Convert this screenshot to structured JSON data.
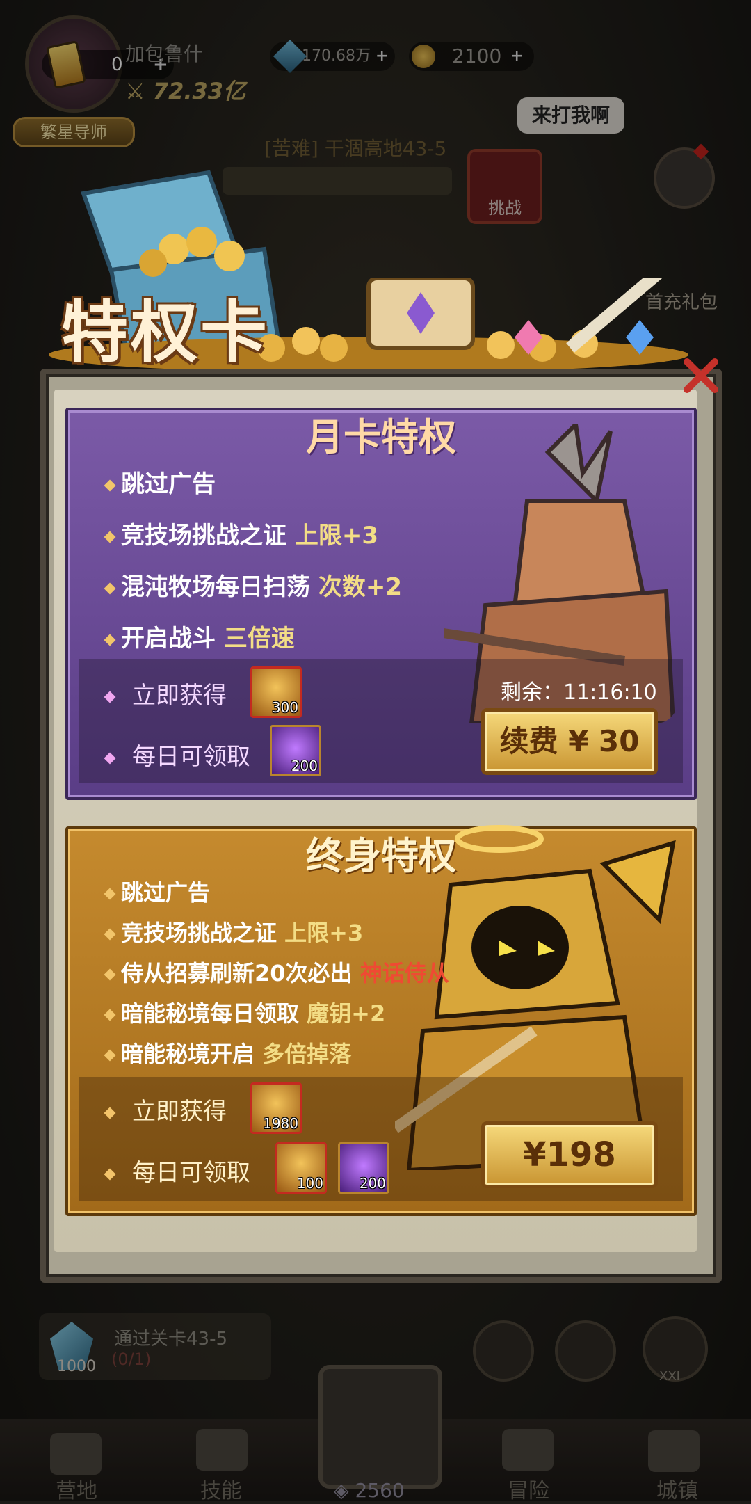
{
  "hud": {
    "card_count": "0",
    "player_name": "加包鲁什",
    "power": "72.33亿",
    "title_badge": "繁星导师",
    "gems": "170.68万",
    "coins": "2100",
    "plus": "+"
  },
  "scene": {
    "speech_bubble": "来打我啊",
    "stage_title": "[苦难] 干涸高地43-5",
    "challenge_label": "挑战",
    "first_pack_label": "首充礼包"
  },
  "modal": {
    "title": "特权卡",
    "monthly": {
      "title": "月卡特权",
      "features": [
        {
          "text": "跳过广告",
          "highlight": ""
        },
        {
          "text": "竞技场挑战之证 ",
          "highlight": "上限+3"
        },
        {
          "text": "混沌牧场每日扫荡 ",
          "highlight": "次数+2"
        },
        {
          "text": "开启战斗 ",
          "highlight": "三倍速"
        }
      ],
      "instant_label": "立即获得",
      "daily_label": "每日可领取",
      "instant_qty": "300",
      "daily_qty": "200",
      "remaining": "剩余：11:16:10",
      "button": "续费 ¥ 30"
    },
    "lifetime": {
      "title": "终身特权",
      "features": [
        {
          "text": "跳过广告",
          "highlight": ""
        },
        {
          "text": "竞技场挑战之证 ",
          "highlight": "上限+3"
        },
        {
          "text": "侍从招募刷新20次必出 ",
          "highlight": "神话侍从"
        },
        {
          "text": "暗能秘境每日领取 ",
          "highlight": "魔钥+2"
        },
        {
          "text": "暗能秘境开启 ",
          "highlight": "多倍掉落"
        }
      ],
      "instant_label": "立即获得",
      "daily_label": "每日可领取",
      "instant_qty": "1980",
      "daily_qty_gold": "100",
      "daily_qty_purple": "200",
      "button": "¥198"
    }
  },
  "quest": {
    "text": "通过关卡43-5",
    "progress": "(0/1)",
    "reward_qty": "1000"
  },
  "level_badge": "XXI",
  "nav": {
    "items": [
      "营地",
      "技能",
      "冒险",
      "城镇"
    ],
    "energy": "2560"
  },
  "colors": {
    "month_panel": "#6a4a98",
    "life_panel": "#b57a24",
    "highlight": "#f3dd86",
    "mythic_red": "#ef4a33"
  }
}
